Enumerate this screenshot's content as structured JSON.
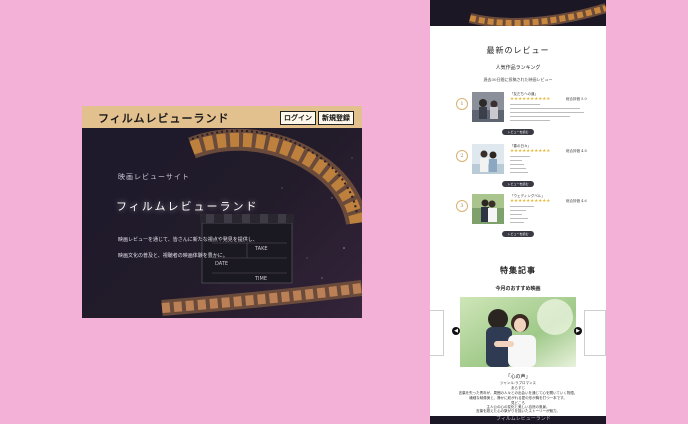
{
  "hero": {
    "logo": "フィルムレビューランド",
    "login_label": "ログイン",
    "register_label": "新規登録",
    "subtitle": "映画レビューサイト",
    "title": "フィルムレビューランド",
    "desc_line1": "映画レビューを通じて、皆さんに新たな視点や発見を提供し、",
    "desc_line2": "映画文化の普及と、視聴者の映画体験を豊かに。",
    "clap_take": "TAKE",
    "clap_date": "DATE",
    "clap_time": "TIME"
  },
  "page": {
    "latest_heading": "最新のレビュー",
    "popular_heading": "人気作品ランキング",
    "popular_sub": "過去30日間に投稿された映画レビュー",
    "reviews": [
      {
        "rank": "1",
        "title": "「友だちへの道」",
        "rating_label": "総合評価 5.0",
        "button": "レビューを読む"
      },
      {
        "rank": "2",
        "title": "「春の日々」",
        "rating_label": "総合評価 4.8",
        "button": "レビューを読む"
      },
      {
        "rank": "3",
        "title": "「ウェディングベル」",
        "rating_label": "総合評価 4.6",
        "button": "レビューを読む"
      }
    ],
    "special_heading": "特集記事",
    "month_heading": "今月のおすすめ映画",
    "feature_title": "「心の声」",
    "feature_line1": "ジャンル:ラブロマンス",
    "feature_line2": "あらすじ",
    "feature_line3": "言葉を失った青年が、周囲の人々との出会いを通じて心を開いていく物語。",
    "feature_line4": "繊細な映像美と、静かに紡がれる愛の形が胸を打つ一本です。",
    "feature_line5": "見どころ",
    "feature_line6": "主人公の心の変化と美しい自然の風景。",
    "feature_line7": "言葉を超えた心の繋がりを描いたストーリーが魅力。",
    "bottom_text": "フィルムレビューランド"
  }
}
